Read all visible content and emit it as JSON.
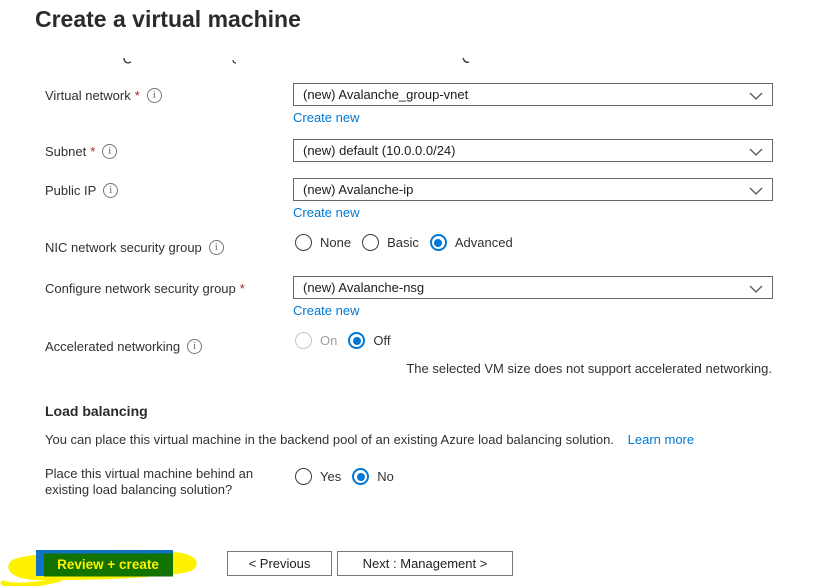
{
  "title": "Create a virtual machine",
  "icons": {
    "info": "i"
  },
  "fields": {
    "virtual_network": {
      "label": "Virtual network",
      "required": "*",
      "value": "(new) Avalanche_group-vnet",
      "create_new": "Create new"
    },
    "subnet": {
      "label": "Subnet",
      "required": "*",
      "value": "(new) default (10.0.0.0/24)"
    },
    "public_ip": {
      "label": "Public IP",
      "value": "(new) Avalanche-ip",
      "create_new": "Create new"
    },
    "nic_nsg": {
      "label": "NIC network security group",
      "options": {
        "none": "None",
        "basic": "Basic",
        "advanced": "Advanced"
      },
      "selected": "Advanced"
    },
    "configure_nsg": {
      "label": "Configure network security group",
      "required": "*",
      "value": "(new) Avalanche-nsg",
      "create_new": "Create new"
    },
    "accelerated_networking": {
      "label": "Accelerated networking",
      "options": {
        "on": "On",
        "off": "Off"
      },
      "selected": "Off",
      "disabled_option": "On",
      "note": "The selected VM size does not support accelerated networking."
    }
  },
  "load_balancing": {
    "heading": "Load balancing",
    "description": "You can place this virtual machine in the backend pool of an existing Azure load balancing solution.",
    "learn_more": "Learn more",
    "question": "Place this virtual machine behind an existing load balancing solution?",
    "options": {
      "yes": "Yes",
      "no": "No"
    },
    "selected": "No"
  },
  "footer": {
    "review_create": "Review + create",
    "previous": "< Previous",
    "next": "Next : Management >"
  },
  "colors": {
    "link_blue": "#0078d4",
    "radio_selected_blue": "#0078d4",
    "required_red": "#a4262c",
    "highlight_yellow": "#fef200",
    "button_blue": "#1173c6",
    "highlight_over_blue_green": "#127300"
  }
}
